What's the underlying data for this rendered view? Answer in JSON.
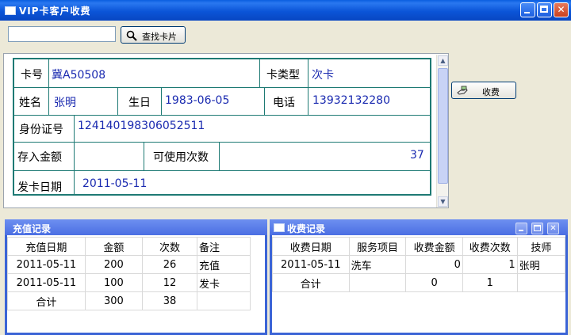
{
  "window": {
    "title": "VIP卡客户收费"
  },
  "search": {
    "value": "",
    "find_button_label": "查找卡片"
  },
  "charge_button_label": "收费",
  "card": {
    "card_no_label": "卡号",
    "card_no": "冀A50508",
    "card_type_label": "卡类型",
    "card_type": "次卡",
    "name_label": "姓名",
    "name": "张明",
    "birthday_label": "生日",
    "birthday": "1983-06-05",
    "phone_label": "电话",
    "phone": "13932132280",
    "id_label": "身份证号",
    "id_no": "124140198306052511",
    "deposit_label": "存入金额",
    "deposit": "",
    "usable_label": "可使用次数",
    "usable_times": "37",
    "issue_date_label": "发卡日期",
    "issue_date": "2011-05-11"
  },
  "recharge": {
    "title": "充值记录",
    "headers": [
      "充值日期",
      "金额",
      "次数",
      "备注"
    ],
    "rows": [
      [
        "2011-05-11",
        "200",
        "26",
        "充值"
      ],
      [
        "2011-05-11",
        "100",
        "12",
        "发卡"
      ]
    ],
    "total": [
      "合计",
      "300",
      "38",
      ""
    ]
  },
  "charge": {
    "title": "收费记录",
    "headers": [
      "收费日期",
      "服务项目",
      "收费金额",
      "收费次数",
      "技师"
    ],
    "rows": [
      [
        "2011-05-11",
        "洗车",
        "0",
        "1",
        "张明"
      ]
    ],
    "total": [
      "合计",
      "",
      "0",
      "1",
      ""
    ]
  }
}
